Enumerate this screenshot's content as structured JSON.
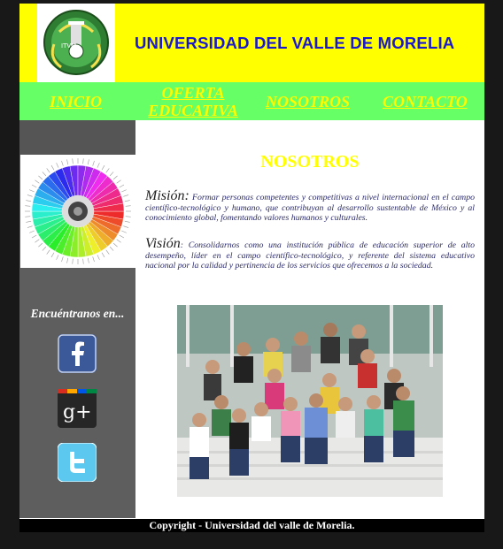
{
  "header": {
    "title": "UNIVERSIDAD DEL VALLE DE MORELIA",
    "logo_text": "ITVM"
  },
  "nav": {
    "items": [
      {
        "label": "INICIO"
      },
      {
        "label": "OFERTA EDUCATIVA"
      },
      {
        "label": "NOSOTROS"
      },
      {
        "label": "CONTACTO"
      }
    ]
  },
  "sidebar": {
    "find_us": "Encuéntranos en..."
  },
  "main": {
    "title": "NOSOTROS",
    "mision_label": "Misión:",
    "mision_text": "Formar personas competentes y competitivas a nivel internacional en el campo científico-tecnológico y humano, que contribuyan al desarrollo sustentable de México y al conocimiento global, fomentando valores humanos y culturales.",
    "vision_label": "Visión",
    "vision_text": ": Consolidarnos como una institución pública de educación superior de alto desempeño, líder en el campo científico-tecnológico, y referente del sistema educativo nacional por la calidad y pertinencia de los servicios que ofrecemos a la sociedad."
  },
  "footer": {
    "copyright": "Copyright - Universidad del valle de Morelia."
  },
  "colors": {
    "header_bg": "#ffff00",
    "nav_bg": "#66ff66",
    "title_blue": "#1a1acc",
    "sidebar_bg": "#5e5e5e"
  },
  "icons": [
    "facebook-icon",
    "google-plus-icon",
    "twitter-icon"
  ]
}
